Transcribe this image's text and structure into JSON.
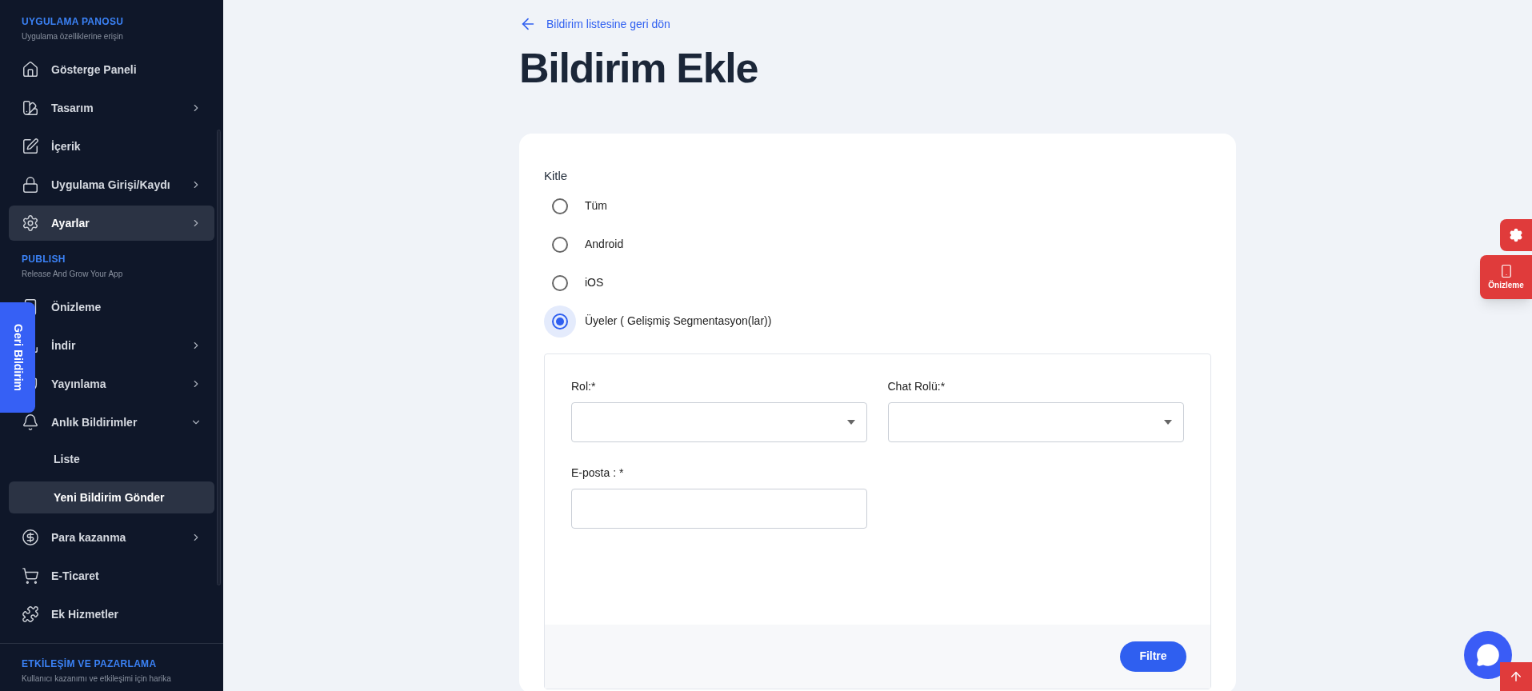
{
  "sidebar": {
    "sections": [
      {
        "title": "UYGULAMA PANOSU",
        "subtitle": "Uygulama özelliklerine erişin",
        "items": [
          {
            "label": "Gösterge Paneli",
            "selected": false
          },
          {
            "label": "Tasarım",
            "selected": false,
            "expanded": false
          },
          {
            "label": "İçerik",
            "selected": false
          },
          {
            "label": "Uygulama Girişi/Kaydı",
            "selected": false,
            "expanded": false
          },
          {
            "label": "Ayarlar",
            "selected": true,
            "expanded": false
          }
        ]
      },
      {
        "title": "PUBLISH",
        "subtitle": "Release And Grow Your App",
        "items": [
          {
            "label": "Önizleme",
            "selected": false
          },
          {
            "label": "İndir",
            "selected": false,
            "expanded": false
          },
          {
            "label": "Yayınlama",
            "selected": false,
            "expanded": false
          },
          {
            "label": "Anlık Bildirimler",
            "selected": false,
            "expanded": true,
            "children": [
              {
                "label": "Liste",
                "selected": false
              },
              {
                "label": "Yeni Bildirim Gönder",
                "selected": true
              }
            ]
          },
          {
            "label": "Para kazanma",
            "selected": false,
            "expanded": false
          },
          {
            "label": "E-Ticaret",
            "selected": false
          },
          {
            "label": "Ek Hizmetler",
            "selected": false
          }
        ]
      },
      {
        "title": "ETKİLEŞİM VE PAZARLAMA",
        "subtitle": "Kullanıcı kazanımı ve etkileşimi için harika"
      }
    ]
  },
  "feedback_tab": "Geri Bildirim",
  "back_link": "Bildirim listesine geri dön",
  "title": "Bildirim Ekle",
  "audience": {
    "label": "Kitle",
    "options": [
      {
        "label": "Tüm",
        "selected": false
      },
      {
        "label": "Android",
        "selected": false
      },
      {
        "label": "iOS",
        "selected": false
      },
      {
        "label": "Üyeler ( Gelişmiş Segmentasyon(lar))",
        "selected": true
      }
    ]
  },
  "filters": {
    "fields": [
      {
        "label": "Rol:*",
        "kind": "select"
      },
      {
        "label": "Chat Rolü:*",
        "kind": "select"
      },
      {
        "label": "E-posta : *",
        "kind": "text"
      }
    ],
    "button": "Filtre"
  },
  "preview_button": "Önizleme"
}
